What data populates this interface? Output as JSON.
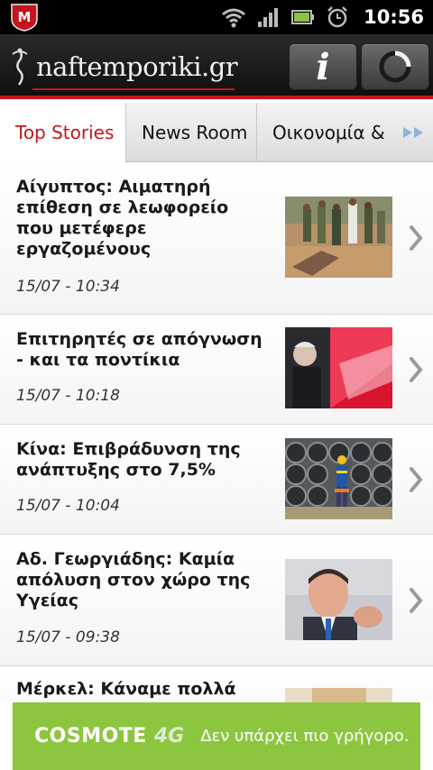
{
  "status_bar": {
    "time": "10:56",
    "icons": [
      "mcafee-icon",
      "wifi-icon",
      "signal-icon",
      "battery-icon",
      "alarm-icon"
    ]
  },
  "header": {
    "logo_text": "naftemporiki.gr",
    "info_label": "i",
    "accent_color": "#c4161c"
  },
  "tabs": [
    {
      "label": "Top Stories",
      "active": true
    },
    {
      "label": "News Room",
      "active": false
    },
    {
      "label": "Οικονομία &",
      "active": false
    }
  ],
  "articles": [
    {
      "title": "Αίγυπτος: Αιματηρή επίθεση σε λεωφορείο που μετέφερε εργαζομένους",
      "date": "15/07 - 10:34",
      "thumb": "soldiers-photo"
    },
    {
      "title": "Επιτηρητές σε απόγνωση - και τα ποντίκια",
      "date": "15/07 - 10:18",
      "thumb": "politician-red-photo"
    },
    {
      "title": "Κίνα: Επιβράδυνση της ανάπτυξης στο 7,5%",
      "date": "15/07 - 10:04",
      "thumb": "pipes-worker-photo"
    },
    {
      "title": "Αδ. Γεωργιάδης: Καμία απόλυση στον χώρο της Υγείας",
      "date": "15/07 - 09:38",
      "thumb": "minister-photo"
    },
    {
      "title": "Μέρκελ: Κάναμε πολλά",
      "date": "",
      "thumb": "partial-photo"
    }
  ],
  "ad": {
    "brand": "COSMOTE",
    "badge": "4G",
    "slogan": "Δεν υπάρχει πιο γρήγορο.",
    "color": "#8cc63f"
  }
}
